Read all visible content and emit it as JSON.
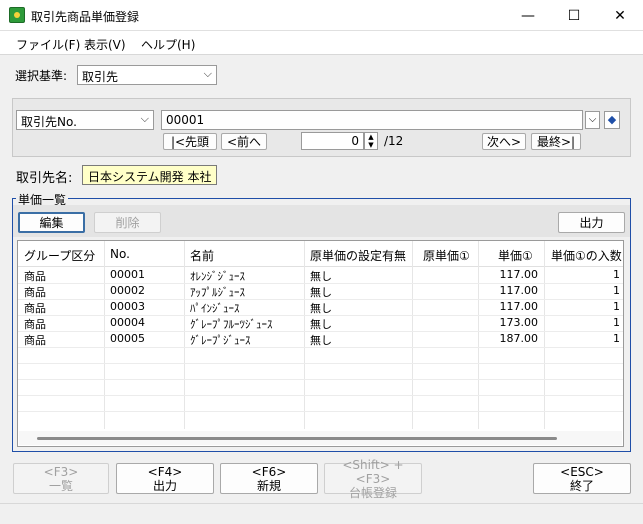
{
  "window": {
    "title": "取引先商品単価登録",
    "minimize": "—",
    "maximize": "☐",
    "close": "✕"
  },
  "menu": [
    {
      "label": "ファイル(F)"
    },
    {
      "label": "表示(V)"
    },
    {
      "label": "ヘルプ(H)"
    }
  ],
  "criteria": {
    "label": "選択基準:",
    "value": "取引先"
  },
  "nav": {
    "field_select": "取引先No.",
    "code_value": "00001",
    "first_label": "|<先頭",
    "prev_label": "<前へ",
    "page_value": "0",
    "page_total": "/12",
    "next_label": "次へ>",
    "last_label": "最終>|"
  },
  "partner": {
    "label": "取引先名:",
    "value": "日本システム開発 本社"
  },
  "price_group": {
    "legend": "単価一覧",
    "edit_label": "編集",
    "delete_label": "削除",
    "output_label": "出力"
  },
  "table": {
    "headers": [
      "グループ区分",
      "No.",
      "名前",
      "原単価の設定有無",
      "原単価①",
      "単価①",
      "単価①の入数"
    ],
    "rows": [
      [
        "商品",
        "00001",
        "ｵﾚﾝｼﾞｼﾞｭｰｽ",
        "無し",
        "",
        "117.00",
        "1"
      ],
      [
        "商品",
        "00002",
        "ｱｯﾌﾟﾙｼﾞｭｰｽ",
        "無し",
        "",
        "117.00",
        "1"
      ],
      [
        "商品",
        "00003",
        "ﾊﾟｲﾝｼﾞｭｰｽ",
        "無し",
        "",
        "117.00",
        "1"
      ],
      [
        "商品",
        "00004",
        "ｸﾞﾚｰﾌﾟﾌﾙｰﾂｼﾞｭｰｽ",
        "無し",
        "",
        "173.00",
        "1"
      ],
      [
        "商品",
        "00005",
        "ｸﾞﾚｰﾌﾟｼﾞｭｰｽ",
        "無し",
        "",
        "187.00",
        "1"
      ]
    ]
  },
  "footer": {
    "f3_key": "<F3>",
    "f3_label": "一覧",
    "f4_key": "<F4>",
    "f4_label": "出力",
    "f6_key": "<F6>",
    "f6_label": "新規",
    "shift_f3_key": "<Shift> + <F3>",
    "shift_f3_label": "台帳登録",
    "esc_key": "<ESC>",
    "esc_label": "終了"
  }
}
